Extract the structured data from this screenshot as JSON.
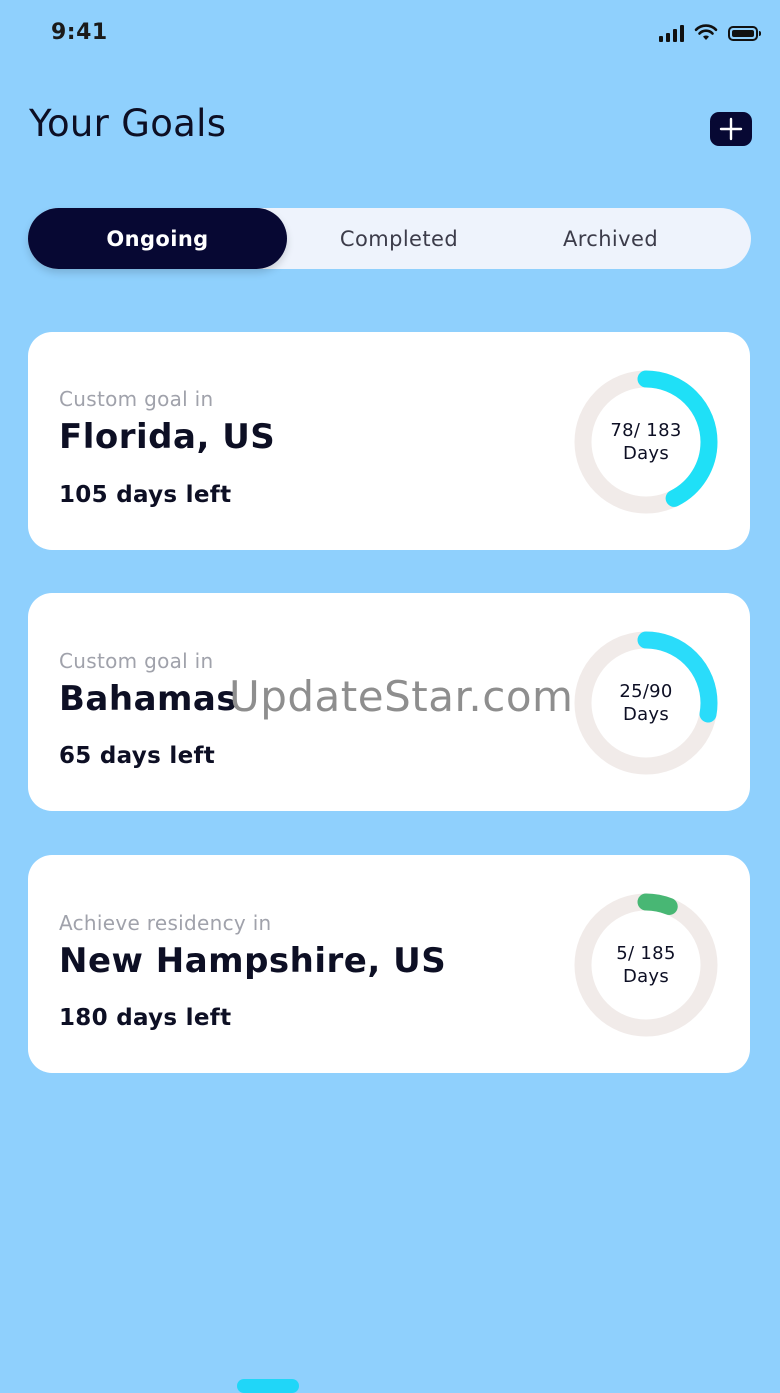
{
  "status_bar": {
    "time": "9:41"
  },
  "header": {
    "title": "Your Goals",
    "add_icon": "plus-icon"
  },
  "tabs": [
    {
      "label": "Ongoing",
      "active": true
    },
    {
      "label": "Completed",
      "active": false
    },
    {
      "label": "Archived",
      "active": false
    }
  ],
  "goals": [
    {
      "kind": "Custom goal in",
      "place": "Florida, US",
      "left": "105 days left",
      "progress": "78/ 183",
      "unit": "Days",
      "current": 78,
      "total": 183,
      "color": "#1fe0f7"
    },
    {
      "kind": "Custom goal in",
      "place": "Bahamas",
      "left": "65 days left",
      "progress": "25/90",
      "unit": "Days",
      "current": 25,
      "total": 90,
      "color": "#2adcfa"
    },
    {
      "kind": "Achieve residency in",
      "place": "New Hampshire, US",
      "left": "180 days left",
      "progress": "5/ 185",
      "unit": "Days",
      "current": 5,
      "total": 185,
      "color": "#48b774"
    }
  ],
  "colors": {
    "background": "#8fd0fd",
    "accent": "#070833",
    "ring_track": "#f1ebe9"
  },
  "watermark": "UpdateStar.com"
}
